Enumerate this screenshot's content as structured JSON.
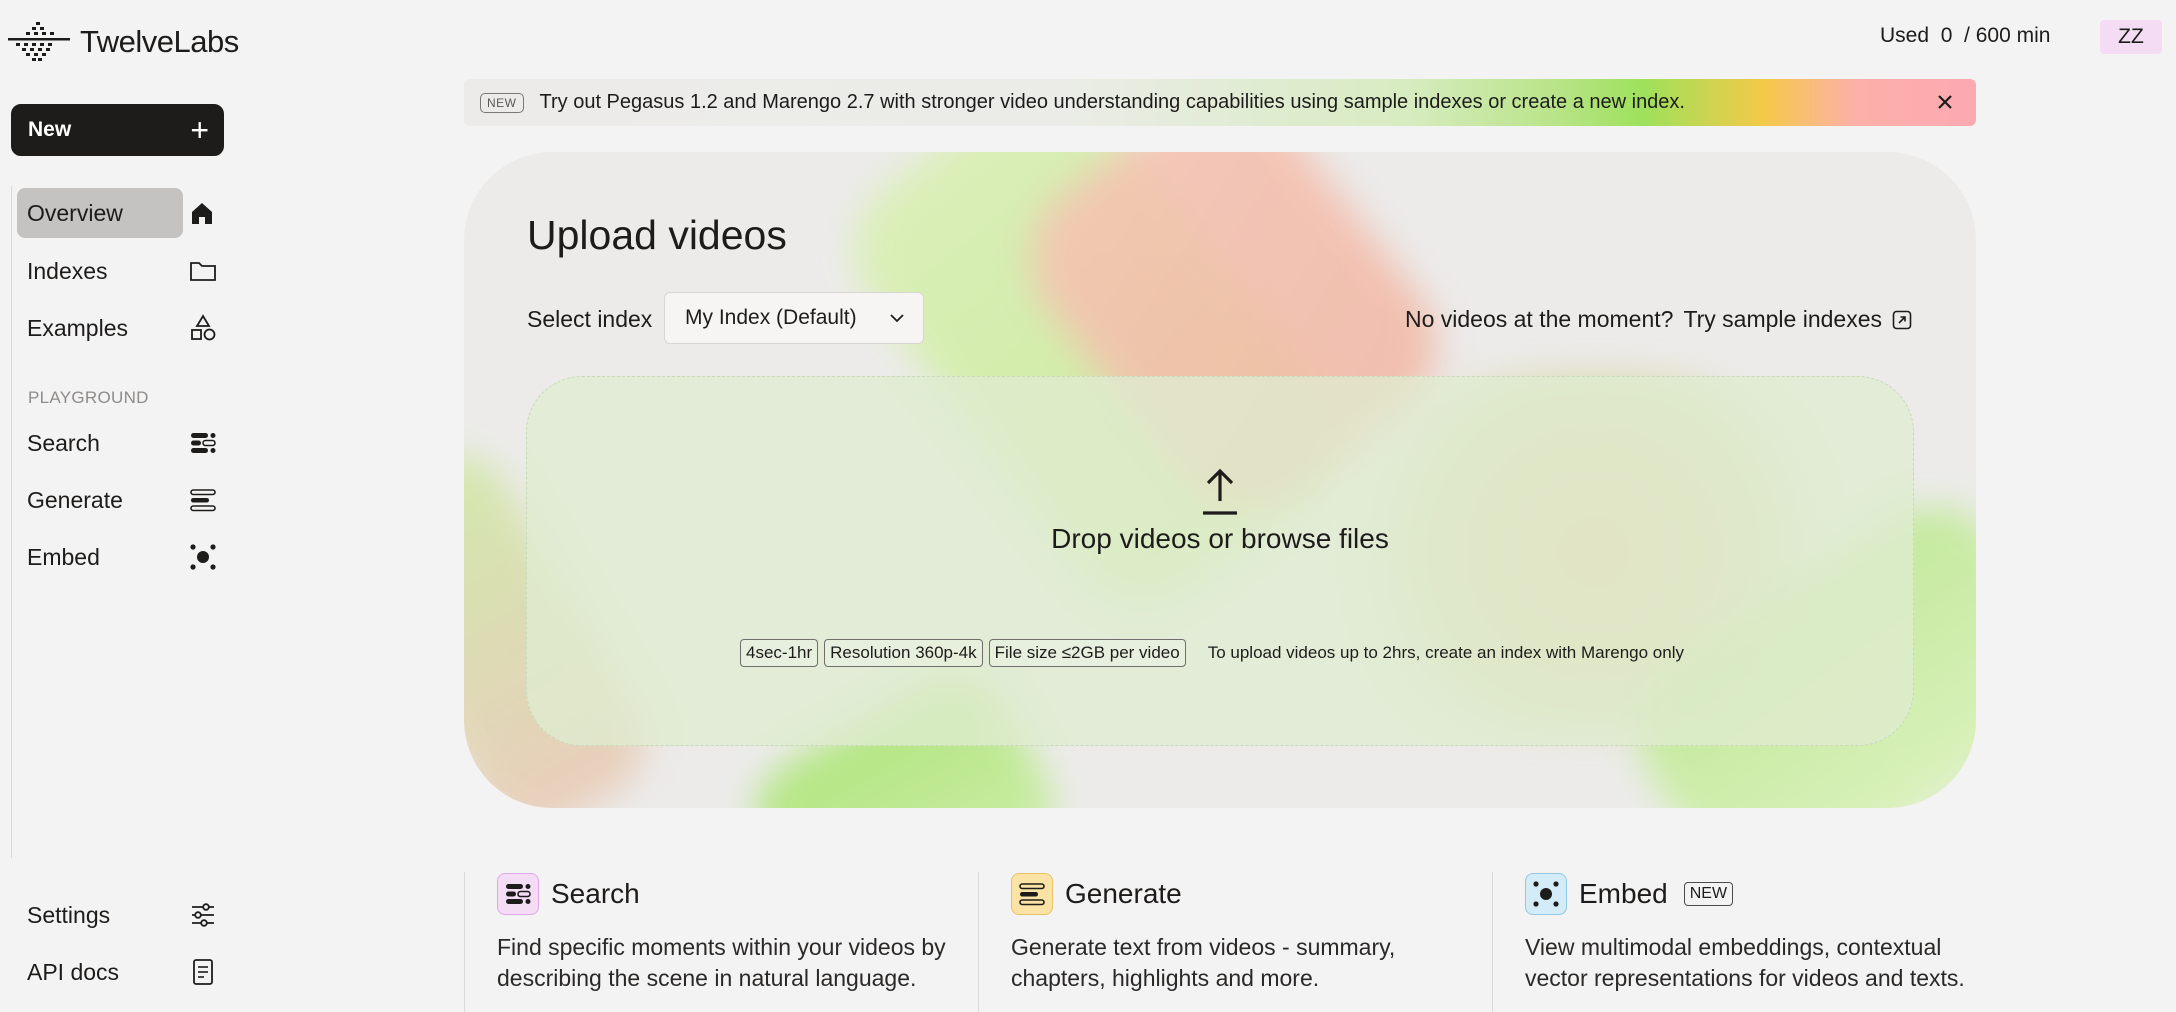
{
  "app": {
    "name": "TwelveLabs"
  },
  "sidebar": {
    "new_label": "New",
    "nav": [
      {
        "label": "Overview",
        "icon": "home-icon",
        "active": true
      },
      {
        "label": "Indexes",
        "icon": "folder-icon"
      },
      {
        "label": "Examples",
        "icon": "shapes-icon"
      }
    ],
    "section_label": "PLAYGROUND",
    "playground": [
      {
        "label": "Search",
        "icon": "search-list-icon"
      },
      {
        "label": "Generate",
        "icon": "generate-lines-icon"
      },
      {
        "label": "Embed",
        "icon": "embed-nodes-icon"
      }
    ],
    "bottom": [
      {
        "label": "Settings",
        "icon": "sliders-icon"
      },
      {
        "label": "API docs",
        "icon": "document-icon"
      }
    ]
  },
  "header": {
    "usage": "Used  0  / 600 min",
    "avatar": "ZZ"
  },
  "banner": {
    "badge": "NEW",
    "text": "Try out Pegasus 1.2 and Marengo 2.7 with stronger video understanding capabilities using sample indexes or create a new index.",
    "close_icon": "close-icon"
  },
  "upload": {
    "title": "Upload videos",
    "select_label": "Select index",
    "selected_index": "My Index (Default)",
    "no_videos_text": "No videos at the moment?",
    "sample_link": "Try sample indexes",
    "drop_text": "Drop videos or browse files",
    "chips": [
      "4sec-1hr",
      "Resolution 360p-4k",
      "File size ≤2GB per video"
    ],
    "note": "To upload videos up to 2hrs, create an index with Marengo only"
  },
  "features": [
    {
      "title": "Search",
      "desc": "Find specific moments within your videos by describing the scene in natural language.",
      "icon_bg": "#f4dcf4",
      "icon_border": "#e0a8e8"
    },
    {
      "title": "Generate",
      "desc": "Generate text from videos - summary, chapters, highlights and more.",
      "icon_bg": "#fbe3a5",
      "icon_border": "#e5c16a"
    },
    {
      "title": "Embed",
      "tag": "NEW",
      "desc": "View multimodal embeddings, contextual vector representations for videos and texts.",
      "icon_bg": "#d3ecf8",
      "icon_border": "#8fc9e6"
    }
  ]
}
